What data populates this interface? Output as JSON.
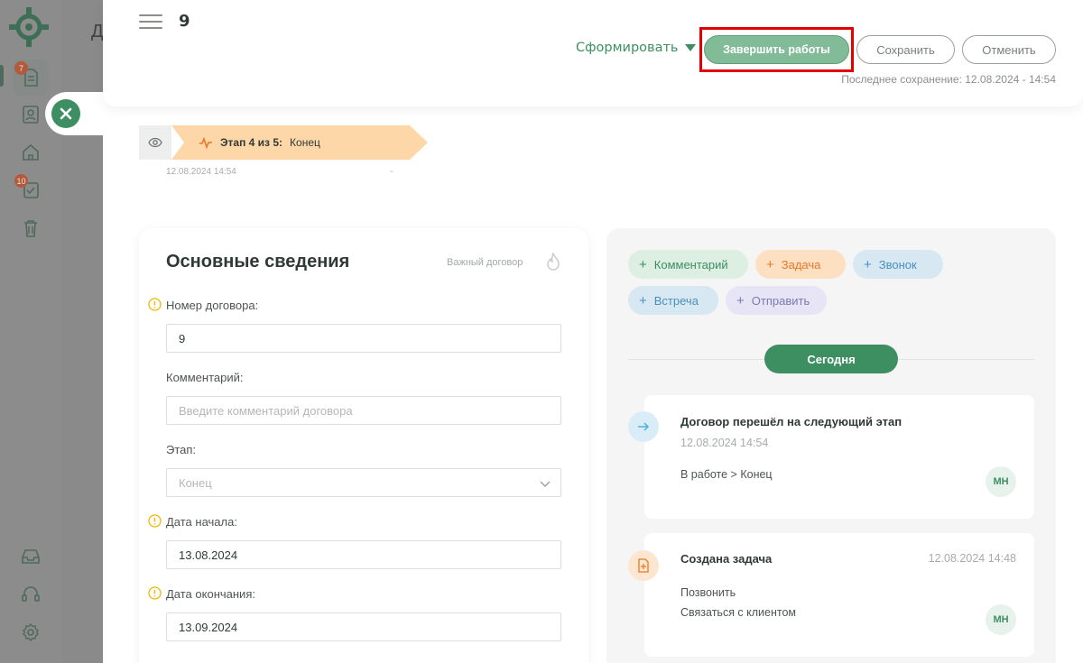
{
  "sidebar": {
    "badges": {
      "deals": "7",
      "tasks": "10"
    },
    "items": [
      "contracts-icon",
      "contacts-icon",
      "home-icon",
      "tasks-icon",
      "trash-icon",
      "inbox-icon",
      "support-icon",
      "settings-icon"
    ]
  },
  "background": {
    "title_fragment": "Д"
  },
  "header": {
    "contract_number": "9",
    "form_label": "Сформировать",
    "finish_label": "Завершить работы",
    "save_label": "Сохранить",
    "cancel_label": "Отменить",
    "last_saved": "Последнее сохранение: 12.08.2024 - 14:54"
  },
  "stage": {
    "label": "Этап 4 из 5:",
    "name": "Конец",
    "date": "12.08.2024 14:54",
    "end": "-"
  },
  "main_info": {
    "title": "Основные сведения",
    "important": "Важный договор",
    "fields": {
      "number_label": "Номер договора:",
      "number_value": "9",
      "comment_label": "Комментарий:",
      "comment_placeholder": "Введите комментарий договора",
      "stage_label": "Этап:",
      "stage_value": "Конец",
      "start_label": "Дата начала:",
      "start_value": "13.08.2024",
      "end_label": "Дата окончания:",
      "end_value": "13.09.2024"
    }
  },
  "activity": {
    "chips": {
      "comment": "Комментарий",
      "task": "Задача",
      "call": "Звонок",
      "meeting": "Встреча",
      "send": "Отправить"
    },
    "today": "Сегодня",
    "events": [
      {
        "title": "Договор перешёл на следующий этап",
        "date": "12.08.2024 14:54",
        "text": "В работе > Конец",
        "avatar": "МН"
      },
      {
        "title": "Создана задача",
        "date": "12.08.2024 14:48",
        "text": "Позвонить",
        "text2": "Связаться с клиентом",
        "avatar": "МН"
      }
    ]
  },
  "colors": {
    "accent": "#3d8f62",
    "finish_button": "#81bb98",
    "stage_fill": "#fdd7a8",
    "highlight": "#e30000"
  }
}
